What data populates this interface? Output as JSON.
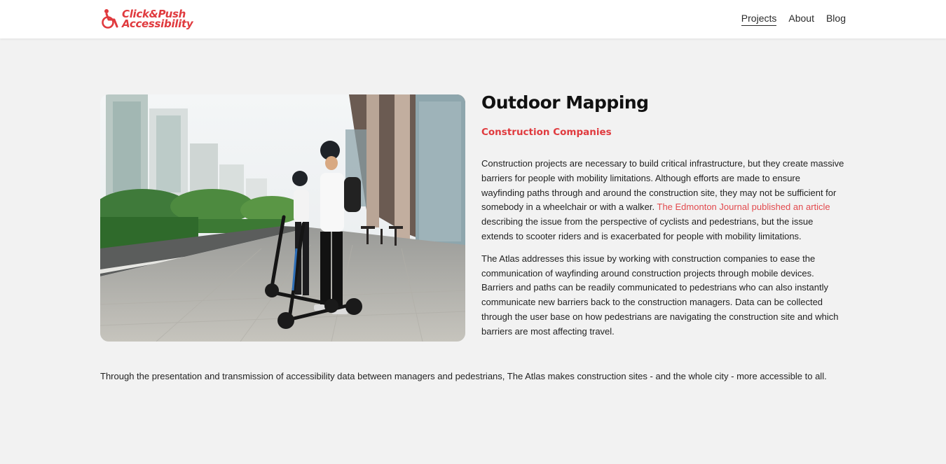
{
  "brand": {
    "line1": "Click&Push",
    "line2": "Accessibility",
    "color": "#e03a3e"
  },
  "nav": {
    "items": [
      {
        "label": "Projects",
        "active": true
      },
      {
        "label": "About",
        "active": false
      },
      {
        "label": "Blog",
        "active": false
      }
    ]
  },
  "article": {
    "title": "Outdoor Mapping",
    "subtitle": "Construction Companies",
    "para1_before": "Construction projects are necessary to build critical infrastructure, but they create massive barriers for people with mobility limitations. Although efforts are made to ensure wayfinding paths through and around the construction site, they may not be sufficient for somebody in a wheelchair or with a walker. ",
    "para1_link": "The Edmonton Journal published an article",
    "para1_after": " describing the issue from the perspective of cyclists and pedestrians, but the issue extends to scooter riders and is exacerbated for people with mobility limitations.",
    "para2": "The Atlas addresses this issue by working with construction companies to ease the communication of wayfinding around construction projects through mobile devices. Barriers and paths can be readily communicated to pedestrians who can also instantly communicate new barriers back to the construction managers. Data can be collected through the user base on how pedestrians are navigating the construction site and which barriers are most affecting travel.",
    "closing": "Through the presentation and transmission of accessibility data between managers and pedestrians, The Atlas makes construction sites - and the whole city - more accessible to all."
  },
  "image": {
    "subject": "two-people-on-electric-scooters-photo"
  },
  "colors": {
    "accent": "#e03a3e",
    "link": "#e24a4e",
    "background": "#f2f2f2"
  }
}
